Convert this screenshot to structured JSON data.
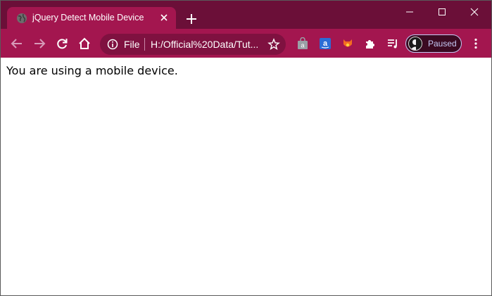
{
  "window": {
    "controls": {
      "minimize": "minimize-icon",
      "maximize": "maximize-icon",
      "close": "close-icon"
    }
  },
  "tab": {
    "title": "jQuery Detect Mobile Device",
    "favicon": "globe-icon"
  },
  "toolbar": {
    "back": "back-arrow-icon",
    "forward": "forward-arrow-icon",
    "reload": "reload-icon",
    "home": "home-icon"
  },
  "omnibox": {
    "scheme_label": "File",
    "url": "H:/Official%20Data/Tut...",
    "info_icon": "info-icon",
    "bookmark_icon": "star-icon"
  },
  "extensions": [
    "shopping-bag-icon",
    "amazon-icon",
    "fox-icon",
    "puzzle-icon",
    "media-queue-icon"
  ],
  "profile": {
    "label": "Paused"
  },
  "page": {
    "text": "You are using a mobile device."
  },
  "colors": {
    "titlebar": "#6b0f38",
    "toolbar": "#a3164f",
    "omnibox": "#7f1140",
    "profile_accent": "#c4c9f5"
  }
}
